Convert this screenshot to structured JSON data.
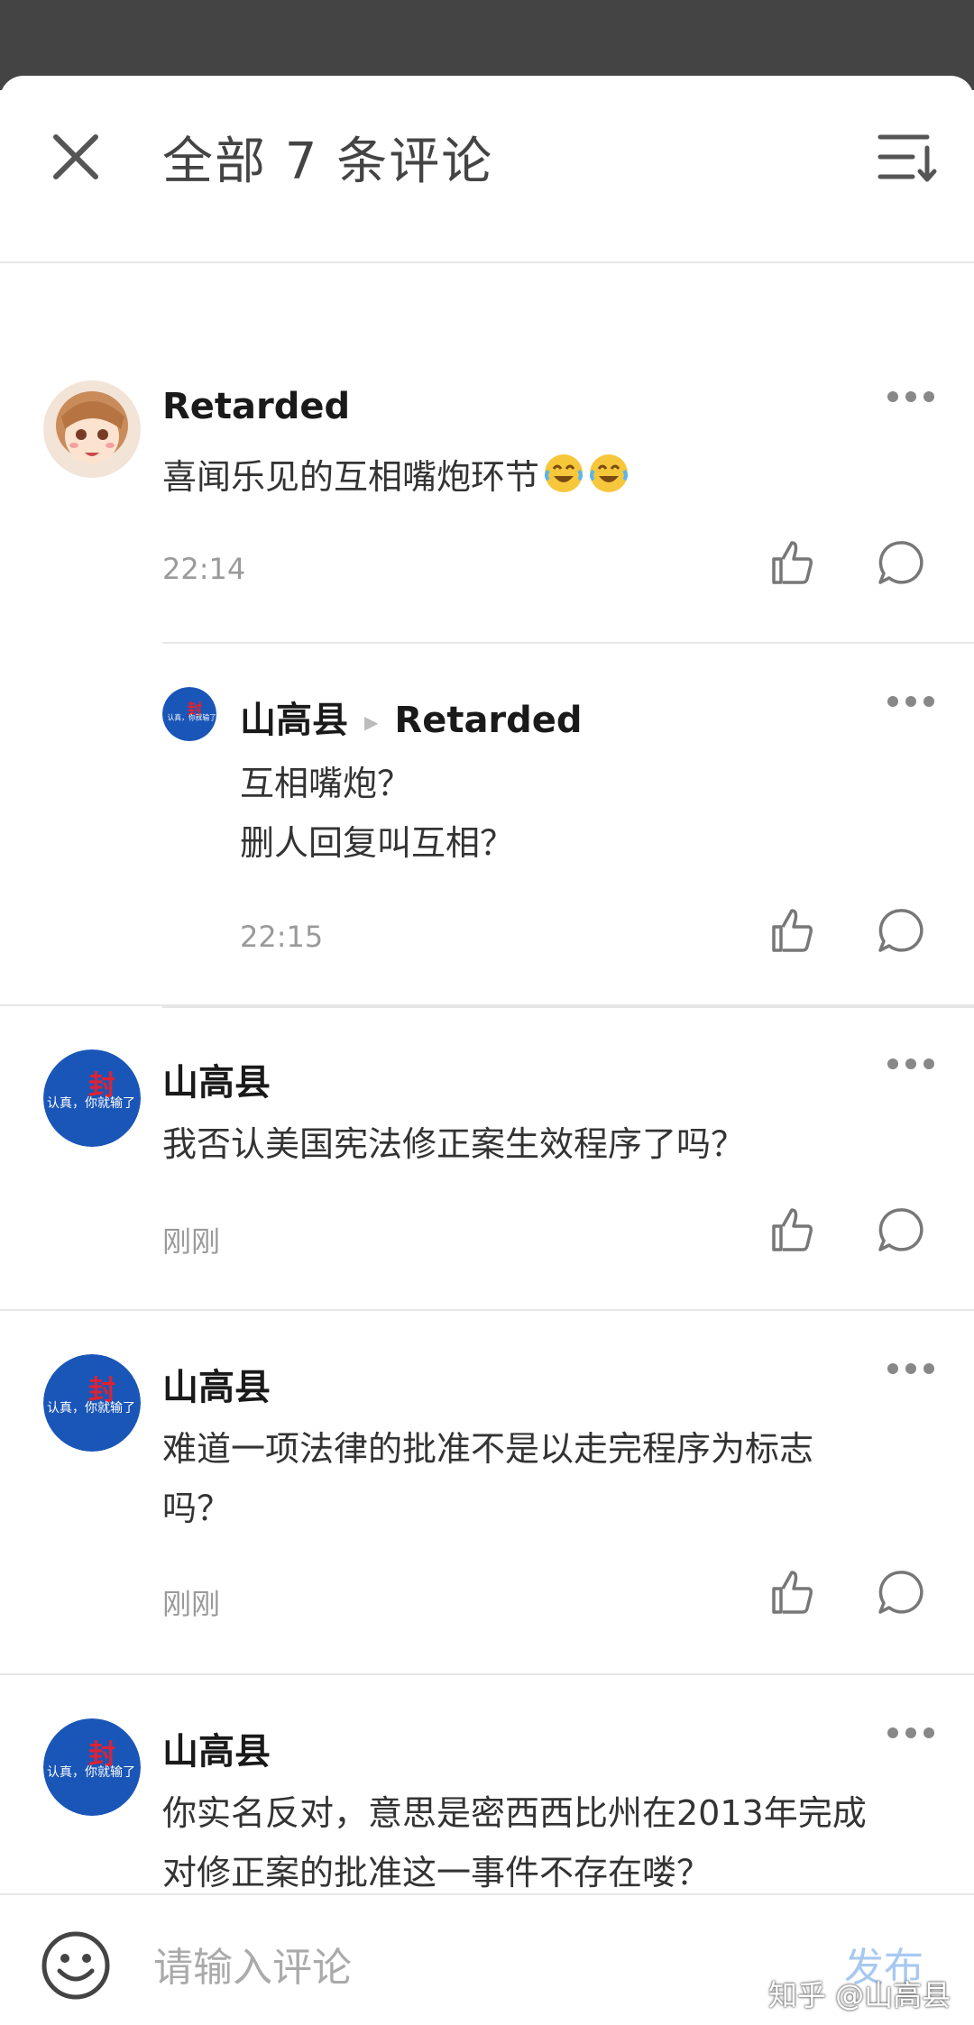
{
  "header": {
    "title": "全部 7 条评论"
  },
  "comments": [
    {
      "author": "Retarded",
      "text": "喜闻乐见的互相嘴炮环节",
      "emojis": [
        "rofl-emoji",
        "rofl-emoji"
      ],
      "time": "22:14"
    },
    {
      "author": "山高县",
      "reply_to": "Retarded",
      "lines": [
        "互相嘴炮？",
        "删人回复叫互相？"
      ],
      "time": "22:15"
    },
    {
      "author": "山高县",
      "text": "我否认美国宪法修正案生效程序了吗？",
      "time": "刚刚"
    },
    {
      "author": "山高县",
      "lines": [
        "难道一项法律的批准不是以走完程序为标志",
        "吗？"
      ],
      "time": "刚刚"
    },
    {
      "author": "山高县",
      "lines": [
        "你实名反对，意思是密西西比州在2013年完成",
        "对修正案的批准这一事件不存在喽？"
      ],
      "time": "刚刚"
    }
  ],
  "bottom_bar": {
    "input_placeholder": "请输入评论",
    "publish_label": "发布",
    "watermark": "知乎 @山高县"
  },
  "icons": {
    "close": "close-icon",
    "sort": "sort-icon",
    "more": "more-icon",
    "like": "thumbs-up-icon",
    "reply": "comment-icon",
    "emoji": "emoji-icon"
  },
  "colors": {
    "top_band": "#444444",
    "divider": "#e6e6e6",
    "meta_text": "#9a9a9a",
    "publish_disabled": "#a8c8f0",
    "avatar_blue": "#1a56b8"
  }
}
